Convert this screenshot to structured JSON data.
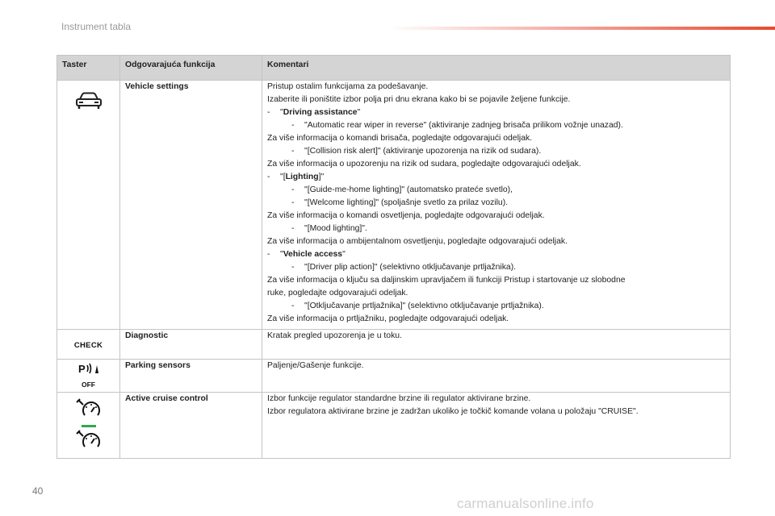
{
  "header": {
    "title": "Instrument tabla",
    "accent_color": "#e64a2e"
  },
  "table": {
    "columns": [
      "Taster",
      "Odgovarajuća funkcija",
      "Komentari"
    ],
    "rows": [
      {
        "icon": "car-icon",
        "function": "Vehicle settings",
        "lines": [
          {
            "text": "Pristup ostalim funkcijama za podešavanje."
          },
          {
            "text": "Izaberite ili poništite izbor polja pri dnu ekrana kako bi se pojavile željene funkcije."
          },
          {
            "prefix": "-",
            "pre": "\"",
            "bold": "Driving assistance",
            "post": "\""
          },
          {
            "sub": true,
            "prefix": "-",
            "text": "\"Automatic rear wiper in reverse\" (aktiviranje zadnjeg brisača prilikom vožnje unazad)."
          },
          {
            "text": "Za više informacija o komandi brisača, pogledajte odgovarajući odeljak."
          },
          {
            "sub": true,
            "prefix": "-",
            "text": "\"[Collision risk alert]\" (aktiviranje upozorenja na rizik od sudara)."
          },
          {
            "text": "Za više informacija o upozorenju na rizik od sudara, pogledajte odgovarajući odeljak."
          },
          {
            "prefix": "-",
            "pre": "\"[",
            "bold": "Lighting",
            "post": "]\""
          },
          {
            "sub": true,
            "prefix": "-",
            "text": "\"[Guide-me-home lighting]\" (automatsko prateće svetlo),"
          },
          {
            "sub": true,
            "prefix": "-",
            "text": "\"[Welcome lighting]\" (spoljašnje svetlo za prilaz vozilu)."
          },
          {
            "text": "Za više informacija o komandi osvetljenja, pogledajte odgovarajući odeljak."
          },
          {
            "sub": true,
            "prefix": "-",
            "text": "\"[Mood lighting]\"."
          },
          {
            "text": "Za više informacija o ambijentalnom osvetljenju, pogledajte odgovarajući odeljak."
          },
          {
            "prefix": "-",
            "pre": "\"",
            "bold": "Vehicle access",
            "post": "\""
          },
          {
            "sub": true,
            "prefix": "-",
            "text": "\"[Driver plip action]\" (selektivno otključavanje prtljažnika)."
          },
          {
            "text": "Za više informacija o ključu sa daljinskim upravljačem ili funkciji Pristup i startovanje uz slobodne"
          },
          {
            "text": "ruke, pogledajte odgovarajući odeljak."
          },
          {
            "sub": true,
            "prefix": "-",
            "text": "\"[Otključavanje prtljažnika]\" (selektivno otključavanje prtljažnika)."
          },
          {
            "text": "Za više informacija o prtljažniku, pogledajte odgovarajući odeljak."
          }
        ]
      },
      {
        "icon": "check-icon",
        "icon_text": "CHECK",
        "function": "Diagnostic",
        "lines": [
          {
            "text": "Kratak pregled upozorenja je u toku."
          }
        ]
      },
      {
        "icon": "parking-sensor-off-icon",
        "icon_text": "OFF",
        "function": "Parking sensors",
        "lines": [
          {
            "text": "Paljenje/Gašenje funkcije."
          }
        ]
      },
      {
        "icon": "cruise-control-icon",
        "function": "Active cruise control",
        "lines": [
          {
            "text": "Izbor funkcije regulator standardne brzine ili regulator aktivirane brzine."
          },
          {
            "text": "Izbor regulatora aktivirane brzine je zadržan ukoliko je točkič komande volana u položaju \"CRUISE\"."
          }
        ]
      }
    ]
  },
  "footer": {
    "page_number": "40",
    "watermark": "carmanualsonline.info",
    "cruise_accent": "#2fa84f"
  }
}
